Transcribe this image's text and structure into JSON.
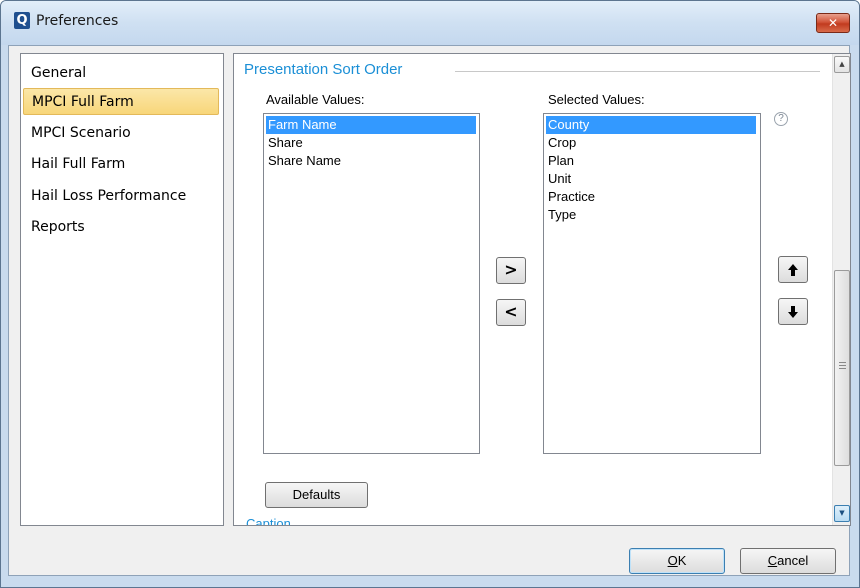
{
  "window": {
    "app_icon_glyph": "Q",
    "title": "Preferences",
    "close_glyph": "✕"
  },
  "sidebar": {
    "items": [
      {
        "label": "General",
        "selected": false
      },
      {
        "label": "MPCI Full Farm",
        "selected": true
      },
      {
        "label": "MPCI Scenario",
        "selected": false
      },
      {
        "label": "Hail Full Farm",
        "selected": false
      },
      {
        "label": "Hail Loss Performance",
        "selected": false
      },
      {
        "label": "Reports",
        "selected": false
      }
    ]
  },
  "section": {
    "title": "Presentation Sort Order",
    "next_section_partial": "Caption"
  },
  "available": {
    "label": "Available Values:",
    "items": [
      "Farm Name",
      "Share",
      "Share Name"
    ],
    "selected_index": 0
  },
  "selected": {
    "label": "Selected Values:",
    "items": [
      "County",
      "Crop",
      "Plan",
      "Unit",
      "Practice",
      "Type"
    ],
    "selected_index": 0
  },
  "buttons": {
    "move_right": ">",
    "move_left": "<",
    "move_up": "🠉",
    "move_down": "🠋",
    "defaults": "Defaults",
    "ok_mnemonic": "O",
    "ok_rest": "K",
    "cancel_mnemonic": "C",
    "cancel_rest": "ancel",
    "help": "?"
  },
  "scrollbar": {
    "up_glyph": "▲",
    "down_glyph": "▼",
    "position_fraction": 0.47
  },
  "colors": {
    "section_title": "#1b8fd6",
    "list_selection": "#3399ff",
    "sidebar_selection": "#f8d67a"
  }
}
